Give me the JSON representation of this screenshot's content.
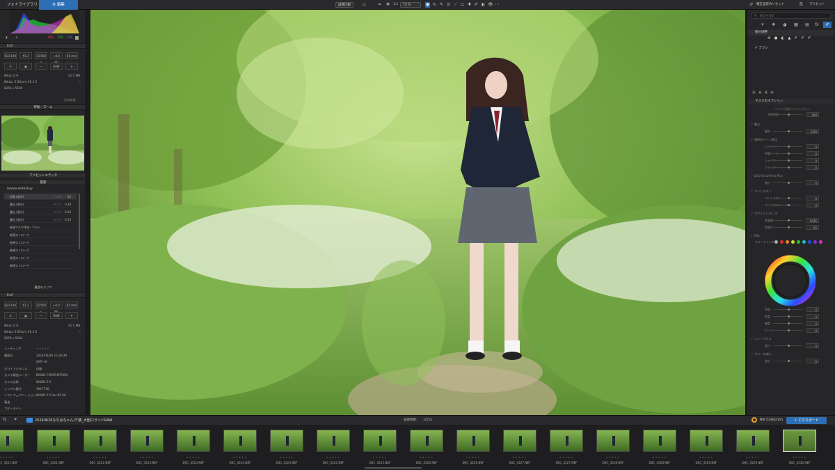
{
  "topbar": {
    "tabs": [
      "フォトライブラリ",
      "編集"
    ],
    "compare_label": "画像比較",
    "zoom_fit": "1:1",
    "zoom_level": "75 %",
    "reset_label": "補正設定のリセット",
    "preset_label": "プリセット"
  },
  "left": {
    "rgb_values": [
      "159,",
      "170,",
      "136"
    ],
    "exif_title": "Exif",
    "exif_cells_row1": [
      "ISO 100",
      "f/1.2",
      "1/2500 s",
      "+0.0 EV",
      "85 mm"
    ],
    "exif_cells_row2": [
      "A",
      "▣",
      "—",
      "RAW",
      "⚲"
    ],
    "camera": "Nikon Z 9",
    "filesize": "51.5 MB",
    "lens": "Nikkor Z 85mm f/1.2 S",
    "lens_extra": "—",
    "dimensions": "8256 x 5504",
    "more_info": "画像情報",
    "move_zoom_title": "移動／ズーム",
    "preset_editor_title": "プリセットエディタ",
    "history_title": "履歴",
    "advanced_history": "Advanced History",
    "history_rows": [
      {
        "label": "反転 (部分)",
        "old": "1.409",
        "val": "55"
      },
      {
        "label": "露出 (部分)",
        "old": "+0.13",
        "val": "0.30"
      },
      {
        "label": "露出 (部分)",
        "old": "+0.13",
        "val": "0.20"
      },
      {
        "label": "露出 (部分)",
        "old": "+0.13",
        "val": "0.10"
      },
      {
        "label": "新規マスク作成・ブラシ",
        "old": "",
        "val": ""
      },
      {
        "label": "新規ストローク",
        "old": "",
        "val": ""
      },
      {
        "label": "新規ストローク",
        "old": "",
        "val": ""
      },
      {
        "label": "新規ストローク",
        "old": "",
        "val": ""
      },
      {
        "label": "新規ストローク",
        "old": "",
        "val": ""
      },
      {
        "label": "新規ストローク",
        "old": "",
        "val": ""
      }
    ],
    "clear_history": "履歴をクリア",
    "exif2_title": "Exif",
    "meta": [
      {
        "k": "レーティング",
        "v": "★★★★★"
      },
      {
        "k": "撮影日",
        "v": "2024/06/26 15:26:49"
      },
      {
        "k": "",
        "v": "GMT+9"
      },
      {
        "k": "ホワイトバランス",
        "v": "自動"
      },
      {
        "k": "カメラ製造メーカー",
        "v": "NIKON CORPORATION"
      },
      {
        "k": "カメラ名称",
        "v": "NIKON Z 9"
      },
      {
        "k": "シリアル番号",
        "v": "3017756"
      },
      {
        "k": "ソフトウェアバージョン",
        "v": "NIKON Z 9 Ver.05.00"
      },
      {
        "k": "著者",
        "v": ""
      },
      {
        "k": "コピーライト",
        "v": ""
      }
    ]
  },
  "right": {
    "search_placeholder": "補正を検索",
    "local_adjust": "部分調整",
    "brush_label": "ブラシ",
    "mask_options": "マスクのオプション",
    "mask_sub": "マスクが選択されていません",
    "opacity_label": "不透明度",
    "opacity_val": "100",
    "exposure_title": "露光",
    "exposure_row": {
      "k": "露光",
      "v": "0.00"
    },
    "tone_title": "選択的トーン補正",
    "tone_rows": [
      {
        "k": "ハイライト",
        "v": "0"
      },
      {
        "k": "中間トーン",
        "v": "0"
      },
      {
        "k": "シャドウ",
        "v": "0"
      },
      {
        "k": "ブラック",
        "v": "0"
      }
    ],
    "clearview_title": "DxO ClearView Plus",
    "clearview_row": {
      "k": "強さ",
      "v": "0"
    },
    "contrast_title": "コントラスト",
    "contrast_rows": [
      {
        "k": "コントラスト",
        "v": "0"
      },
      {
        "k": "マイクロコントラスト",
        "v": "0"
      }
    ],
    "wb_title": "ホワイトバランス",
    "wb_rows": [
      {
        "k": "色温度",
        "v": "5036"
      },
      {
        "k": "色被り",
        "v": "25"
      }
    ],
    "hsl_title": "HSL",
    "channel_label": "カラーチャンネル",
    "hsl_rows": [
      {
        "k": "色相",
        "v": "0"
      },
      {
        "k": "彩度",
        "v": "0"
      },
      {
        "k": "輝度",
        "v": "0"
      },
      {
        "k": "カーブ",
        "v": "0"
      }
    ],
    "sharp_title": "シャープネス",
    "sharp_row": {
      "k": "強さ",
      "v": "0"
    },
    "blur_title": "ブラーの減少",
    "blur_row": {
      "k": "強さ",
      "v": "0"
    }
  },
  "filmstrip": {
    "folder": "20240626ななはちゃん(ケ鶴_大胆ロランドRAW",
    "count_label": "画像枚数：",
    "count": "1/253",
    "nik_label": "Nik Collection",
    "export_label": "エクスポート",
    "files": [
      "DSC_4521.NEF",
      "DSC_4521.NEF",
      "DSC_4522.NEF",
      "DSC_4523.NEF",
      "DSC_4523.NEF",
      "DSC_4524.NEF",
      "DSC_4524.NEF",
      "DSC_4525.NEF",
      "DSC_4525.NEF",
      "DSC_4526.NEF",
      "DSC_4526.NEF",
      "DSC_4527.NEF",
      "DSC_4527.NEF",
      "DSC_4528.NEF",
      "DSC_4528.NEF",
      "DSC_4529.NEF",
      "DSC_4529.NEF",
      "DSC_4530.NEF"
    ]
  }
}
